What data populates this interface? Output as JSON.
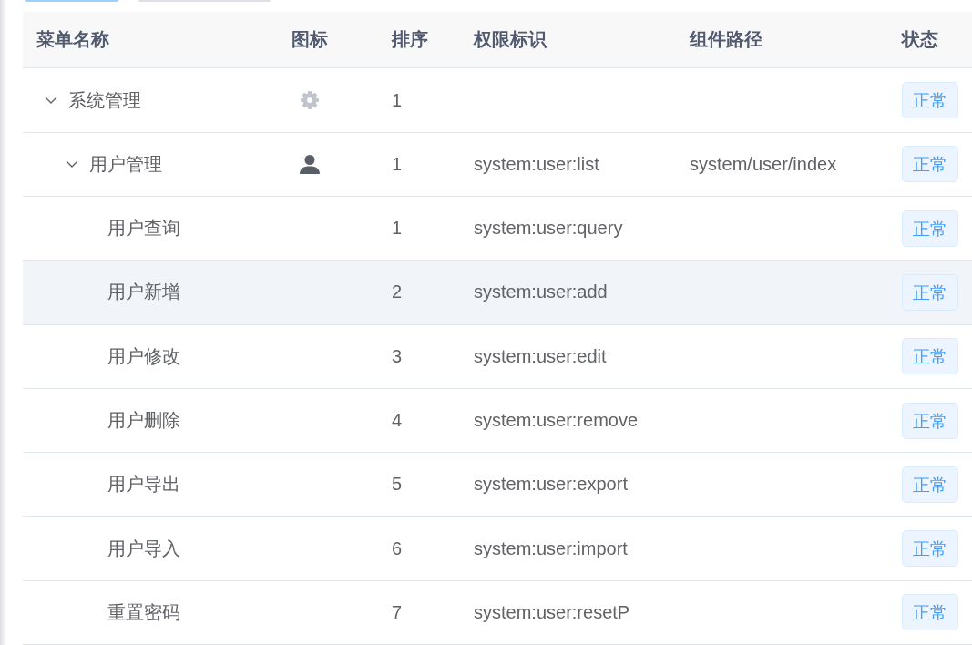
{
  "toolbar_buttons": [
    {
      "kind": "primary"
    },
    {
      "kind": "plain"
    }
  ],
  "table": {
    "columns": [
      "菜单名称",
      "图标",
      "排序",
      "权限标识",
      "组件路径",
      "状态"
    ],
    "rows": [
      {
        "name": "系统管理",
        "expanded": true,
        "highlighted": false,
        "icon": {
          "kind": "gear"
        },
        "order": "1",
        "status": "正常",
        "children": [
          {
            "name": "用户管理",
            "expanded": true,
            "highlighted": false,
            "icon": {
              "kind": "user"
            },
            "order": "1",
            "perms": "system:user:list",
            "component": "system/user/index",
            "status": "正常",
            "children": [
              {
                "name": "用户查询",
                "highlighted": false,
                "order": "1",
                "perms": "system:user:query",
                "status": "正常"
              },
              {
                "name": "用户新增",
                "highlighted": true,
                "order": "2",
                "perms": "system:user:add",
                "status": "正常"
              },
              {
                "name": "用户修改",
                "highlighted": false,
                "order": "3",
                "perms": "system:user:edit",
                "status": "正常"
              },
              {
                "name": "用户删除",
                "highlighted": false,
                "order": "4",
                "perms": "system:user:remove",
                "status": "正常"
              },
              {
                "name": "用户导出",
                "highlighted": false,
                "order": "5",
                "perms": "system:user:export",
                "status": "正常"
              },
              {
                "name": "用户导入",
                "highlighted": false,
                "order": "6",
                "perms": "system:user:import",
                "status": "正常"
              },
              {
                "name": "重置密码",
                "highlighted": false,
                "order": "7",
                "perms": "system:user:resetP",
                "status": "正常"
              }
            ]
          }
        ]
      }
    ]
  }
}
